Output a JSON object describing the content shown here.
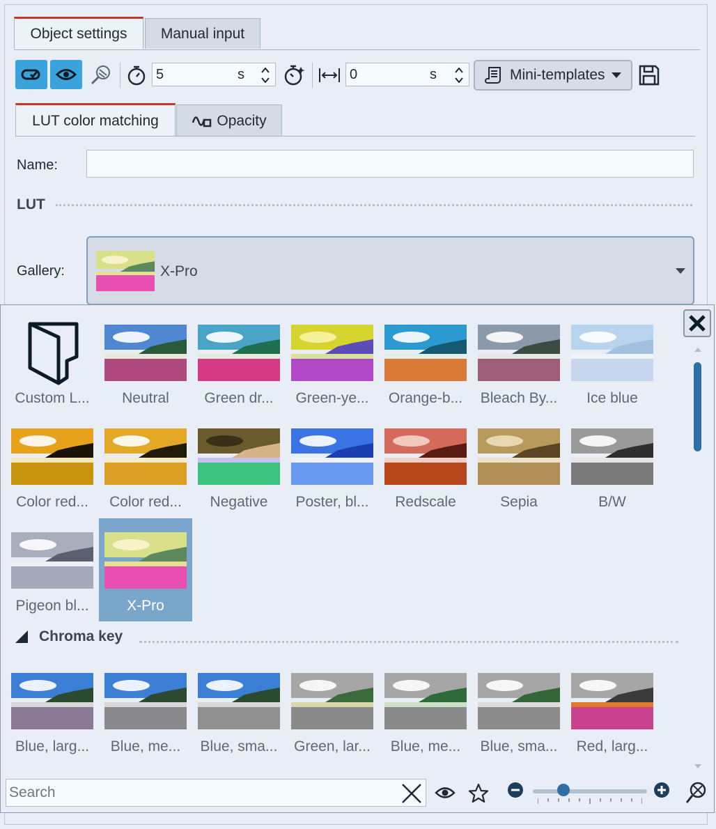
{
  "tabs_top": [
    {
      "label": "Object settings",
      "active": true
    },
    {
      "label": "Manual input",
      "active": false
    }
  ],
  "toolbar": {
    "duration_value": "5",
    "duration_unit": "s",
    "offset_value": "0",
    "offset_unit": "s",
    "mini_templates_label": "Mini-templates"
  },
  "tabs_sub": [
    {
      "label": "LUT color matching",
      "active": true
    },
    {
      "label": "Opacity",
      "active": false
    }
  ],
  "form": {
    "name_label": "Name:",
    "name_value": "",
    "lut_section": "LUT",
    "gallery_label": "Gallery:",
    "gallery_selected": "X-Pro"
  },
  "gallery_items": [
    {
      "label": "Custom L...",
      "icon": "folder-icon"
    },
    {
      "label": "Neutral"
    },
    {
      "label": "Green dr..."
    },
    {
      "label": "Green-ye..."
    },
    {
      "label": "Orange-b..."
    },
    {
      "label": "Bleach By..."
    },
    {
      "label": "Ice blue"
    },
    {
      "label": "Color red..."
    },
    {
      "label": "Color red..."
    },
    {
      "label": "Negative"
    },
    {
      "label": "Poster, bl..."
    },
    {
      "label": "Redscale"
    },
    {
      "label": "Sepia"
    },
    {
      "label": "B/W"
    },
    {
      "label": "Pigeon bl..."
    },
    {
      "label": "X-Pro",
      "selected": true
    }
  ],
  "chroma": {
    "title": "Chroma key",
    "items": [
      {
        "label": "Blue, larg..."
      },
      {
        "label": "Blue, me..."
      },
      {
        "label": "Blue, sma..."
      },
      {
        "label": "Green, lar..."
      },
      {
        "label": "Blue, me..."
      },
      {
        "label": "Blue, sma..."
      },
      {
        "label": "Red, larg..."
      }
    ]
  },
  "bottom": {
    "search_placeholder": "Search",
    "zoom_level": 0.27
  },
  "colors": {
    "accent": "#3aa3dc",
    "tab_marker": "#c0392b",
    "selection": "#7aa6cc",
    "scrollbar": "#2f6fa7"
  }
}
